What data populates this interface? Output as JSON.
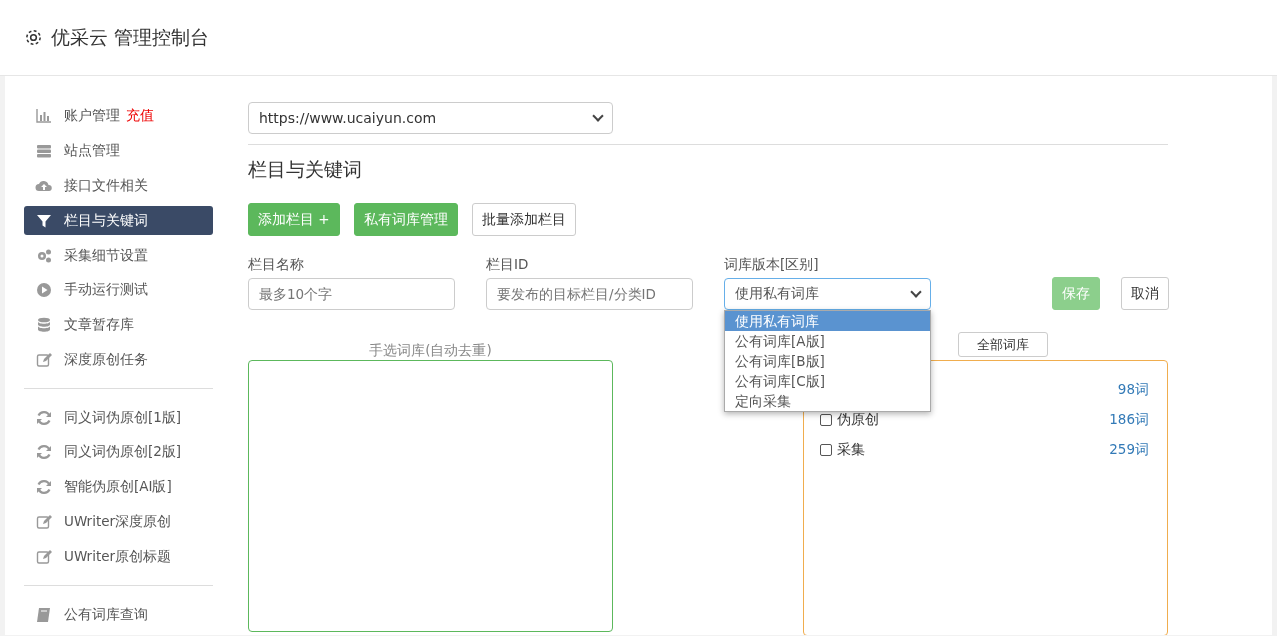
{
  "header": {
    "title": "优采云 管理控制台"
  },
  "sidebar": {
    "items": [
      {
        "kind": "item",
        "label": "账户管理",
        "badge": "充值",
        "selected": false
      },
      {
        "kind": "item",
        "label": "站点管理",
        "selected": false
      },
      {
        "kind": "item",
        "label": "接口文件相关",
        "selected": false
      },
      {
        "kind": "item",
        "label": "栏目与关键词",
        "selected": true
      },
      {
        "kind": "item",
        "label": "采集细节设置",
        "selected": false
      },
      {
        "kind": "item",
        "label": "手动运行测试",
        "selected": false
      },
      {
        "kind": "item",
        "label": "文章暂存库",
        "selected": false
      },
      {
        "kind": "item",
        "label": "深度原创任务",
        "selected": false
      },
      {
        "kind": "divider"
      },
      {
        "kind": "item",
        "label": "同义词伪原创[1版]",
        "selected": false
      },
      {
        "kind": "item",
        "label": "同义词伪原创[2版]",
        "selected": false
      },
      {
        "kind": "item",
        "label": "智能伪原创[AI版]",
        "selected": false
      },
      {
        "kind": "item",
        "label": "UWriter深度原创",
        "selected": false
      },
      {
        "kind": "item",
        "label": "UWriter原创标题",
        "selected": false
      },
      {
        "kind": "divider"
      },
      {
        "kind": "item",
        "label": "公有词库查询",
        "selected": false
      }
    ]
  },
  "site_select": {
    "value": "https://www.ucaiyun.com"
  },
  "section_title": "栏目与关键词",
  "buttons": [
    {
      "label": "添加栏目 +",
      "kind": "success"
    },
    {
      "label": "私有词库管理",
      "kind": "success"
    },
    {
      "label": "批量添加栏目",
      "kind": "default"
    }
  ],
  "form": {
    "name": {
      "label": "栏目名称",
      "placeholder": "最多10个字"
    },
    "id": {
      "label": "栏目ID",
      "placeholder": "要发布的目标栏目/分类ID"
    },
    "version": {
      "label": "词库版本[区别]",
      "value": "使用私有词库",
      "options": [
        {
          "label": "使用私有词库",
          "selected": true
        },
        {
          "label": "公有词库[A版]",
          "selected": false
        },
        {
          "label": "公有词库[B版]",
          "selected": false
        },
        {
          "label": "公有词库[C版]",
          "selected": false
        },
        {
          "label": "定向采集",
          "selected": false
        }
      ]
    },
    "save": "保存",
    "cancel": "取消"
  },
  "manual_box": {
    "label": "手选词库(自动去重)"
  },
  "all_button": "全部词库",
  "libraries": [
    {
      "count": "98词"
    },
    {
      "label": "伪原创",
      "count": "186词",
      "checked": false
    },
    {
      "label": "采集",
      "count": "259词",
      "checked": false
    }
  ]
}
